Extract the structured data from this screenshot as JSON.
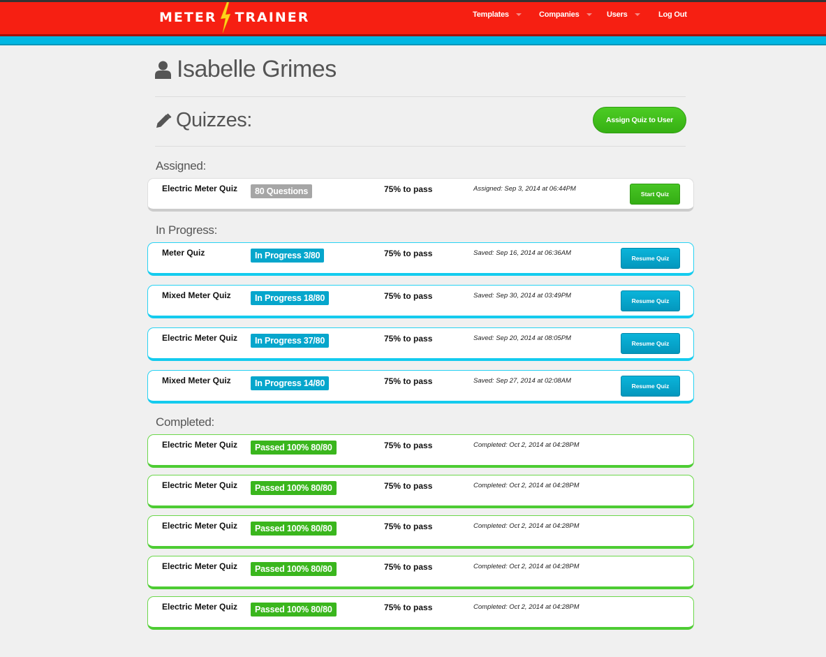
{
  "header": {
    "logo_left": "METER",
    "logo_right": "TRAINER",
    "nav": [
      {
        "label": "Templates",
        "has_dropdown": true
      },
      {
        "label": "Companies",
        "has_dropdown": true
      },
      {
        "label": "Users",
        "has_dropdown": true
      },
      {
        "label": "Log Out",
        "has_dropdown": false
      }
    ]
  },
  "colors": {
    "brand_red": "#f61f12",
    "accent_blue": "#00b7e3",
    "success_green": "#3ab61d",
    "neutral_grey": "#a6a6a6"
  },
  "user": {
    "icon": "user-icon",
    "name": "Isabelle Grimes"
  },
  "quizzes": {
    "icon": "pencil-icon",
    "title": "Quizzes:",
    "assign_button": "Assign Quiz to User"
  },
  "sections": {
    "assigned": {
      "label": "Assigned:",
      "items": [
        {
          "name": "Electric Meter Quiz",
          "badge": "80 Questions",
          "pass": "75% to pass",
          "date": "Assigned: Sep 3, 2014 at 06:44PM",
          "action": "Start Quiz"
        }
      ]
    },
    "in_progress": {
      "label": "In Progress:",
      "items": [
        {
          "name": "Meter Quiz",
          "badge": "In Progress 3/80",
          "pass": "75% to pass",
          "date": "Saved: Sep 16, 2014 at 06:36AM",
          "action": "Resume Quiz"
        },
        {
          "name": "Mixed Meter Quiz",
          "badge": "In Progress 18/80",
          "pass": "75% to pass",
          "date": "Saved: Sep 30, 2014 at 03:49PM",
          "action": "Resume Quiz"
        },
        {
          "name": "Electric Meter Quiz",
          "badge": "In Progress 37/80",
          "pass": "75% to pass",
          "date": "Saved: Sep 20, 2014 at 08:05PM",
          "action": "Resume Quiz"
        },
        {
          "name": "Mixed Meter Quiz",
          "badge": "In Progress 14/80",
          "pass": "75% to pass",
          "date": "Saved: Sep 27, 2014 at 02:08AM",
          "action": "Resume Quiz"
        }
      ]
    },
    "completed": {
      "label": "Completed:",
      "items": [
        {
          "name": "Electric Meter Quiz",
          "badge": "Passed 100% 80/80",
          "pass": "75% to pass",
          "date": "Completed: Oct 2, 2014 at 04:28PM"
        },
        {
          "name": "Electric Meter Quiz",
          "badge": "Passed 100% 80/80",
          "pass": "75% to pass",
          "date": "Completed: Oct 2, 2014 at 04:28PM"
        },
        {
          "name": "Electric Meter Quiz",
          "badge": "Passed 100% 80/80",
          "pass": "75% to pass",
          "date": "Completed: Oct 2, 2014 at 04:28PM"
        },
        {
          "name": "Electric Meter Quiz",
          "badge": "Passed 100% 80/80",
          "pass": "75% to pass",
          "date": "Completed: Oct 2, 2014 at 04:28PM"
        },
        {
          "name": "Electric Meter Quiz",
          "badge": "Passed 100% 80/80",
          "pass": "75% to pass",
          "date": "Completed: Oct 2, 2014 at 04:28PM"
        }
      ]
    }
  }
}
